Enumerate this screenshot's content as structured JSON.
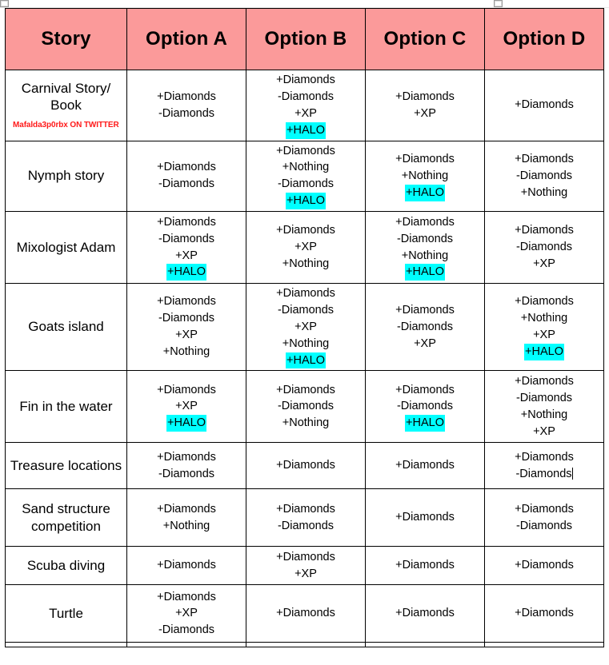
{
  "window": {
    "handles": [
      "table-move-handle",
      "table-resize-handle"
    ]
  },
  "watermark": {
    "text": "Mafalda3p0rbx ON TWITTER",
    "color": "#ff1a1a"
  },
  "colors": {
    "header_fill": "#fb9a9a",
    "halo_highlight": "#00ffff",
    "grid_line": "#000000",
    "text": "#000000"
  },
  "table": {
    "headers": [
      "Story",
      "Option A",
      "Option B",
      "Option C",
      "Option D"
    ],
    "rows": [
      {
        "story": "Carnival Story/ Book",
        "has_watermark": true,
        "option_a": [
          "+Diamonds",
          "-Diamonds"
        ],
        "option_b": [
          "+Diamonds",
          "-Diamonds",
          "+XP",
          "+HALO"
        ],
        "option_b_halo": true,
        "option_c": [
          "+Diamonds",
          "+XP"
        ],
        "option_c_halo": false,
        "option_d": [
          "+Diamonds"
        ],
        "option_d_halo": false,
        "option_a_halo": false
      },
      {
        "story": "Nymph story",
        "has_watermark": false,
        "option_a": [
          "+Diamonds",
          "-Diamonds"
        ],
        "option_a_halo": false,
        "option_b": [
          "+Diamonds",
          "+Nothing",
          "-Diamonds",
          "+HALO"
        ],
        "option_b_halo": true,
        "option_c": [
          "+Diamonds",
          "+Nothing",
          "+HALO"
        ],
        "option_c_halo": true,
        "option_d": [
          "+Diamonds",
          "-Diamonds",
          "+Nothing"
        ],
        "option_d_halo": false
      },
      {
        "story": "Mixologist Adam",
        "has_watermark": false,
        "option_a": [
          "+Diamonds",
          "-Diamonds",
          "+XP",
          "+HALO"
        ],
        "option_a_halo": true,
        "option_b": [
          "+Diamonds",
          "+XP",
          "+Nothing"
        ],
        "option_b_halo": false,
        "option_c": [
          "+Diamonds",
          "-Diamonds",
          "+Nothing",
          "+HALO"
        ],
        "option_c_halo": true,
        "option_d": [
          "+Diamonds",
          "-Diamonds",
          "+XP"
        ],
        "option_d_halo": false
      },
      {
        "story": "Goats island",
        "has_watermark": false,
        "option_a": [
          "+Diamonds",
          "-Diamonds",
          "+XP",
          "+Nothing"
        ],
        "option_a_halo": false,
        "option_b": [
          "+Diamonds",
          "-Diamonds",
          "+XP",
          "+Nothing",
          "+HALO"
        ],
        "option_b_halo": true,
        "option_c": [
          "+Diamonds",
          "-Diamonds",
          "+XP"
        ],
        "option_c_halo": false,
        "option_d": [
          "+Diamonds",
          "+Nothing",
          "+XP",
          "+HALO"
        ],
        "option_d_halo": true
      },
      {
        "story": "Fin in the water",
        "has_watermark": false,
        "option_a": [
          "+Diamonds",
          "+XP",
          "+HALO"
        ],
        "option_a_halo": true,
        "option_b": [
          "+Diamonds",
          "-Diamonds",
          "+Nothing"
        ],
        "option_b_halo": false,
        "option_c": [
          "+Diamonds",
          "-Diamonds",
          "+HALO"
        ],
        "option_c_halo": true,
        "option_d": [
          "+Diamonds",
          "-Diamonds",
          "+Nothing",
          "+XP"
        ],
        "option_d_halo": false
      },
      {
        "story": "Treasure locations",
        "has_watermark": false,
        "option_a": [
          "+Diamonds",
          "-Diamonds"
        ],
        "option_a_halo": false,
        "option_b": [
          "+Diamonds"
        ],
        "option_b_halo": false,
        "option_c": [
          "+Diamonds"
        ],
        "option_c_halo": false,
        "option_d": [
          "+Diamonds",
          "-Diamonds"
        ],
        "option_d_halo": false,
        "option_d_caret": true
      },
      {
        "story": "Sand structure competition",
        "has_watermark": false,
        "option_a": [
          "+Diamonds",
          "+Nothing"
        ],
        "option_a_halo": false,
        "option_b": [
          "+Diamonds",
          "-Diamonds"
        ],
        "option_b_halo": false,
        "option_c": [
          "+Diamonds"
        ],
        "option_c_halo": false,
        "option_d": [
          "+Diamonds",
          "-Diamonds"
        ],
        "option_d_halo": false
      },
      {
        "story": "Scuba diving",
        "has_watermark": false,
        "option_a": [
          "+Diamonds"
        ],
        "option_a_halo": false,
        "option_b": [
          "+Diamonds",
          "+XP"
        ],
        "option_b_halo": false,
        "option_c": [
          "+Diamonds"
        ],
        "option_c_halo": false,
        "option_d": [
          "+Diamonds"
        ],
        "option_d_halo": false
      },
      {
        "story": "Turtle",
        "has_watermark": false,
        "option_a": [
          "+Diamonds",
          "+XP",
          "-Diamonds"
        ],
        "option_a_halo": false,
        "option_b": [
          "+Diamonds"
        ],
        "option_b_halo": false,
        "option_c": [
          "+Diamonds"
        ],
        "option_c_halo": false,
        "option_d": [
          "+Diamonds"
        ],
        "option_d_halo": false
      },
      {
        "story": "",
        "has_watermark": false,
        "option_a": [],
        "option_a_halo": false,
        "option_b": [],
        "option_b_halo": false,
        "option_c": [],
        "option_c_halo": false,
        "option_d": [],
        "option_d_halo": false
      }
    ]
  }
}
